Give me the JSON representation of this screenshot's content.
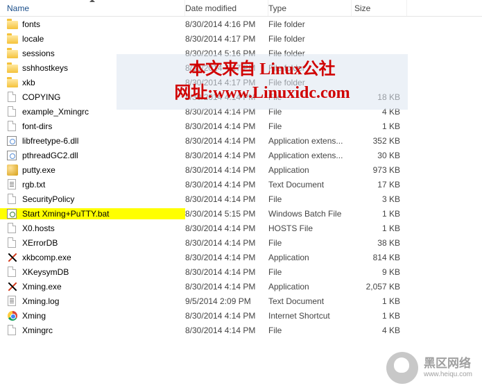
{
  "columns": {
    "name": "Name",
    "date": "Date modified",
    "type": "Type",
    "size": "Size"
  },
  "files": [
    {
      "icon": "folder",
      "name": "fonts",
      "date": "8/30/2014 4:16 PM",
      "type": "File folder",
      "size": ""
    },
    {
      "icon": "folder",
      "name": "locale",
      "date": "8/30/2014 4:17 PM",
      "type": "File folder",
      "size": ""
    },
    {
      "icon": "folder",
      "name": "sessions",
      "date": "8/30/2014 5:16 PM",
      "type": "File folder",
      "size": ""
    },
    {
      "icon": "folder",
      "name": "sshhostkeys",
      "date": "8/30/2014 4:17 PM",
      "type": "File folder",
      "size": ""
    },
    {
      "icon": "folder",
      "name": "xkb",
      "date": "8/30/2014 4:17 PM",
      "type": "File folder",
      "size": ""
    },
    {
      "icon": "file",
      "name": "COPYING",
      "date": "8/30/2014 4:14 PM",
      "type": "File",
      "size": "18 KB"
    },
    {
      "icon": "file",
      "name": "example_Xmingrc",
      "date": "8/30/2014 4:14 PM",
      "type": "File",
      "size": "4 KB"
    },
    {
      "icon": "file",
      "name": "font-dirs",
      "date": "8/30/2014 4:14 PM",
      "type": "File",
      "size": "1 KB"
    },
    {
      "icon": "dll",
      "name": "libfreetype-6.dll",
      "date": "8/30/2014 4:14 PM",
      "type": "Application extens...",
      "size": "352 KB"
    },
    {
      "icon": "dll",
      "name": "pthreadGC2.dll",
      "date": "8/30/2014 4:14 PM",
      "type": "Application extens...",
      "size": "30 KB"
    },
    {
      "icon": "putty",
      "name": "putty.exe",
      "date": "8/30/2014 4:14 PM",
      "type": "Application",
      "size": "973 KB"
    },
    {
      "icon": "text",
      "name": "rgb.txt",
      "date": "8/30/2014 4:14 PM",
      "type": "Text Document",
      "size": "17 KB"
    },
    {
      "icon": "file",
      "name": "SecurityPolicy",
      "date": "8/30/2014 4:14 PM",
      "type": "File",
      "size": "3 KB"
    },
    {
      "icon": "bat",
      "name": "Start Xming+PuTTY.bat",
      "date": "8/30/2014 5:15 PM",
      "type": "Windows Batch File",
      "size": "1 KB",
      "highlighted": true
    },
    {
      "icon": "file",
      "name": "X0.hosts",
      "date": "8/30/2014 4:14 PM",
      "type": "HOSTS File",
      "size": "1 KB"
    },
    {
      "icon": "file",
      "name": "XErrorDB",
      "date": "8/30/2014 4:14 PM",
      "type": "File",
      "size": "38 KB"
    },
    {
      "icon": "x",
      "name": "xkbcomp.exe",
      "date": "8/30/2014 4:14 PM",
      "type": "Application",
      "size": "814 KB"
    },
    {
      "icon": "file",
      "name": "XKeysymDB",
      "date": "8/30/2014 4:14 PM",
      "type": "File",
      "size": "9 KB"
    },
    {
      "icon": "x",
      "name": "Xming.exe",
      "date": "8/30/2014 4:14 PM",
      "type": "Application",
      "size": "2,057 KB"
    },
    {
      "icon": "text",
      "name": "Xming.log",
      "date": "9/5/2014 2:09 PM",
      "type": "Text Document",
      "size": "1 KB"
    },
    {
      "icon": "chrome",
      "name": "Xming",
      "date": "8/30/2014 4:14 PM",
      "type": "Internet Shortcut",
      "size": "1 KB"
    },
    {
      "icon": "file",
      "name": "Xmingrc",
      "date": "8/30/2014 4:14 PM",
      "type": "File",
      "size": "4 KB"
    }
  ],
  "overlay": {
    "line1": "本文来自 Linux公社",
    "line2": "网址:www.Linuxidc.com"
  },
  "brand": {
    "cn": "黑区网络",
    "en": "www.heiqu.com"
  }
}
